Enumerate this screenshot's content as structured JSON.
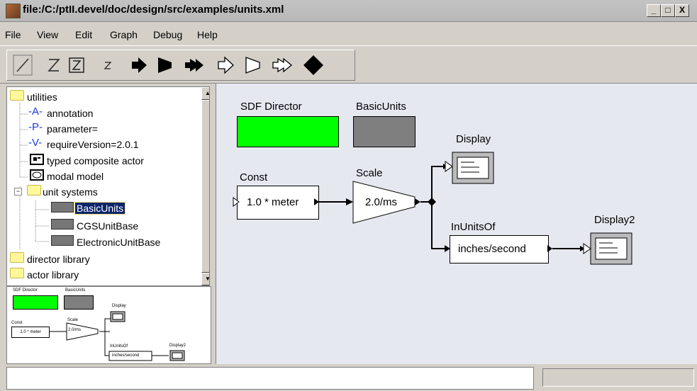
{
  "window": {
    "title": "file:/C:/ptII.devel/doc/design/src/examples/units.xml",
    "minimize_label": "_",
    "maximize_label": "□",
    "close_label": "X"
  },
  "menu": [
    "File",
    "View",
    "Edit",
    "Graph",
    "Debug",
    "Help"
  ],
  "toolbar": {
    "buttons": [
      "zoom-reset-icon",
      "zoom-in-icon",
      "zoom-fit-icon",
      "zoom-out-icon",
      "play-icon",
      "pause-icon",
      "step-icon",
      "play-outline-icon",
      "pause-outline-icon",
      "step-outline-icon",
      "stop-icon"
    ]
  },
  "tree": {
    "items": [
      {
        "label": "utilities",
        "icon": "folder-open-icon"
      },
      {
        "label": "annotation",
        "icon": "A"
      },
      {
        "label": "parameter=",
        "icon": "P"
      },
      {
        "label": "requireVersion=2.0.1",
        "icon": "V"
      },
      {
        "label": "typed composite actor",
        "icon": "composite-icon"
      },
      {
        "label": "modal model",
        "icon": "modal-icon"
      },
      {
        "label": "unit systems",
        "icon": "folder-open-icon"
      },
      {
        "label": "BasicUnits",
        "icon": "unit-box-icon"
      },
      {
        "label": "CGSUnitBase",
        "icon": "unit-box-icon"
      },
      {
        "label": "ElectronicUnitBase",
        "icon": "unit-box-icon"
      },
      {
        "label": "director library",
        "icon": "folder-icon"
      },
      {
        "label": "actor library",
        "icon": "folder-icon"
      }
    ]
  },
  "overview": {
    "director": "SDF Director",
    "units": "BasicUnits",
    "display": "Display",
    "const": "Const",
    "const_value": "1.0 * meter",
    "scale": "Scale",
    "scale_value": "2.0/ms",
    "inunits": "InUnitsOf",
    "inunits_value": "inches/second",
    "display2": "Display2"
  },
  "canvas": {
    "director_label": "SDF Director",
    "director_color": "#00ff00",
    "units_label": "BasicUnits",
    "units_color": "#7f7f7f",
    "const_label": "Const",
    "const_value": "1.0 * meter",
    "scale_label": "Scale",
    "scale_value": "2.0/ms",
    "display_label": "Display",
    "inunits_label": "InUnitsOf",
    "inunits_value": "inches/second",
    "display2_label": "Display2"
  },
  "status": {
    "text": ""
  }
}
